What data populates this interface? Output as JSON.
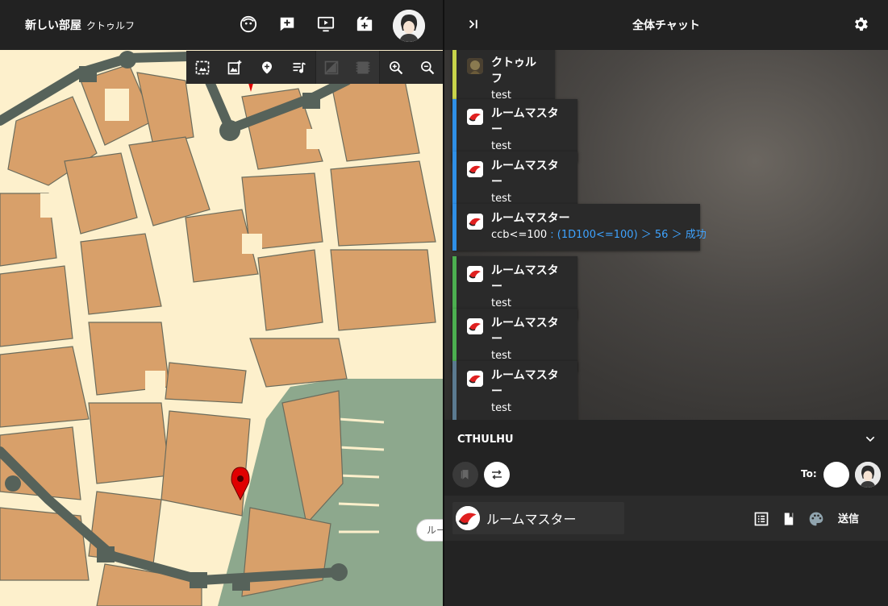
{
  "room": {
    "title": "新しい部屋",
    "subtitle": "クトゥルフ"
  },
  "top_toolbar": {
    "icons": [
      "character-face-icon",
      "add-board-icon",
      "screen-play-icon",
      "scene-edit-icon"
    ]
  },
  "map_toolbar": {
    "icons": [
      "background-image-icon",
      "add-image-icon",
      "add-marker-icon",
      "playlist-icon",
      "grid-icon",
      "film-icon",
      "zoom-in-icon",
      "zoom-out-icon"
    ]
  },
  "map_edge_label": "ルー",
  "chat": {
    "title": "全体チャット",
    "messages": [
      {
        "name": "クトゥルフ",
        "text": "test",
        "bar_color": "#c8d44a",
        "avatar": "character"
      },
      {
        "name": "ルームマスター",
        "text": "test",
        "bar_color": "#2f8fe6",
        "avatar": "gm"
      },
      {
        "name": "ルームマスター",
        "text": "test",
        "bar_color": "#2f8fe6",
        "avatar": "gm"
      },
      {
        "name": "ルームマスター",
        "text": "ccb<=100",
        "dice": " : (1D100<=100) ＞ 56 ＞ 成功",
        "bar_color": "#2f8fe6",
        "avatar": "gm"
      },
      {
        "name": "ルームマスター",
        "text": "test",
        "bar_color": "#4caf50",
        "avatar": "gm"
      },
      {
        "name": "ルームマスター",
        "text": "test",
        "bar_color": "#4caf50",
        "avatar": "gm"
      },
      {
        "name": "ルームマスター",
        "text": "test",
        "bar_color": "#5b7a90",
        "avatar": "gm"
      }
    ]
  },
  "input": {
    "system": "CTHULHU",
    "to_label": "To:",
    "speaker": "ルームマスター",
    "send_label": "送信"
  },
  "colors": {
    "map_bg": "#fdf0cc",
    "building": "#d8a06a",
    "wall": "#56625a",
    "water": "#8da88d",
    "dice_result": "#3ea3ff"
  }
}
